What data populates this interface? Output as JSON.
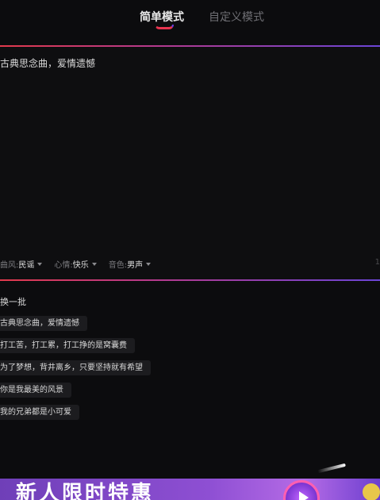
{
  "tabs": {
    "simple_label": "简单模式",
    "custom_label": "自定义模式"
  },
  "prompt": {
    "value": "古典思念曲，爱情遗憾"
  },
  "options": {
    "style_key": "曲风:",
    "style_value": "民谣",
    "mood_key": "心情:",
    "mood_value": "快乐",
    "voice_key": "音色:",
    "voice_value": "男声"
  },
  "counter": "1",
  "refresh_label": "换一批",
  "suggestions": [
    "古典思念曲，爱情遗憾",
    "打工苦，打工累，打工挣的是窝囊费",
    "为了梦想，背井离乡，只要坚持就有希望",
    "你是我最美的风景",
    "我的兄弟都是小可爱"
  ],
  "banner": {
    "title": "新人限时特惠"
  },
  "colors": {
    "accent_red": "#e23a4c",
    "accent_purple": "#6b45d6",
    "background": "#0c0c0e"
  }
}
